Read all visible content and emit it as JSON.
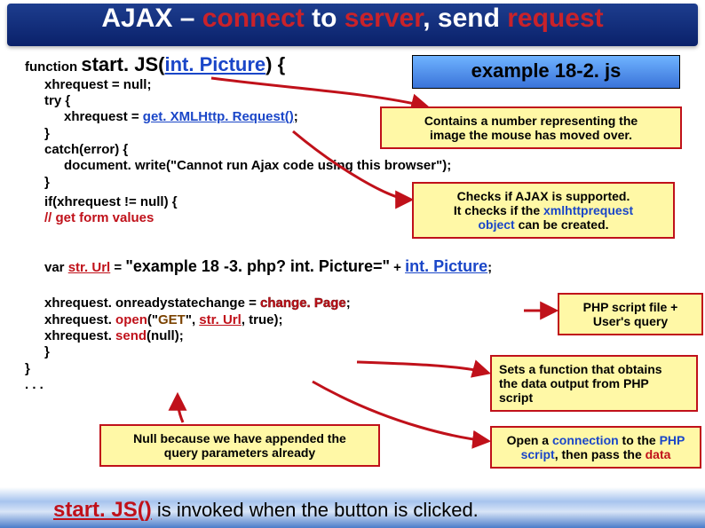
{
  "title": {
    "prefix": "AJAX – ",
    "red1": "connect",
    "mid1": " to ",
    "red2": "server",
    "mid2": ", send ",
    "red3": "request"
  },
  "file_label": "example 18-2. js",
  "code": {
    "l1a": "function ",
    "l1b": "start. JS(",
    "l1c": "int. Picture",
    "l1d": ") {",
    "l2": "xhrequest = null;",
    "l3": "try {",
    "l4a": "xhrequest = ",
    "l4b": "get. XMLHttp. Request()",
    "l4c": ";",
    "l5": "}",
    "l6": "catch(error) {",
    "l7": "document. write(\"Cannot run Ajax code using this browser\");",
    "l8": "}",
    "l9": "if(xhrequest != null) {",
    "l10": "// get form values",
    "l11a": "var ",
    "l11b": "str. Url",
    "l11c": " = ",
    "l11d": "\"example 18 -3. php? int. Picture=\"",
    "l11e": " + ",
    "l11f": "int. Picture",
    "l11g": ";",
    "l12a": "xhrequest. onreadystatechange = ",
    "l12b": "change. Page",
    "l12c": ";",
    "l13a": "xhrequest. ",
    "l13b": "open",
    "l13c": "(\"",
    "l13d": "GET",
    "l13e": "\", ",
    "l13f": "str. Url",
    "l13g": ", true);",
    "l14a": "xhrequest. ",
    "l14b": "send",
    "l14c": "(null);",
    "l15": "}",
    "l16": "}",
    "l17": ". . ."
  },
  "call_intpic_l1": "Contains a number representing the",
  "call_intpic_l2": "image the mouse has moved over.",
  "call_ajax_l1": "Checks if AJAX is supported.",
  "call_ajax_l2a": "It checks if the ",
  "call_ajax_l2b": "xmlhttprequest",
  "call_ajax_l3a": "object",
  "call_ajax_l3b": " can be created.",
  "call_php_l1": "PHP script file +",
  "call_php_l2": "User's query",
  "call_change_l1": "Sets a function that obtains",
  "call_change_l2": "the data output from PHP",
  "call_change_l3": "script",
  "call_open_l1a": "Open a ",
  "call_open_l1b": "connection",
  "call_open_l1c": " to the ",
  "call_open_l1d": "PHP",
  "call_open_l2a": "script",
  "call_open_l2b": ", then pass the ",
  "call_open_l2c": "data",
  "call_null_l1": "Null because we have appended the",
  "call_null_l2": "query parameters already",
  "bottom": {
    "fn": "start. JS()",
    "rest": " is invoked when the button is clicked."
  }
}
